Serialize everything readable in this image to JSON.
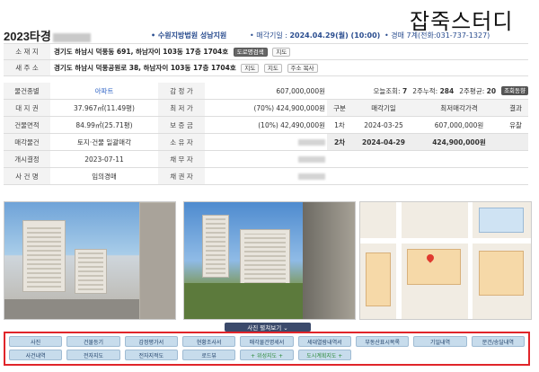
{
  "brand": "잡죽스터디",
  "header": {
    "case_number": "2023타경",
    "court": "• 수원지방법원 성남지원",
    "sale_date_label": "• 매각기일 : ",
    "sale_date": "2024.04.29(월) (10:00)",
    "sale_team": "• 경매 7계(전화:031-737-1327)"
  },
  "address": {
    "location_label": "소 재 지",
    "location": "경기도 하남시 덕풍동 691, 하남자이 103동 17층 1704호",
    "road_label": "새 주 소",
    "road": "경기도 하남시 덕풍공원로 38, 하남자이 103동 17층 1704호",
    "buttons": [
      "도로명검색",
      "지도",
      "지도",
      "지도",
      "주소 복사"
    ]
  },
  "details": [
    {
      "label": "물건종별",
      "value": "아파트",
      "label2": "감 정 가",
      "value2": "607,000,000원"
    },
    {
      "label": "대 지 권",
      "value": "37.967㎡(11.49평)",
      "label2": "최 저 가",
      "value2": "(70%) 424,900,000원"
    },
    {
      "label": "건물면적",
      "value": "84.99㎡(25.71평)",
      "label2": "보 증 금",
      "value2": "(10%) 42,490,000원"
    },
    {
      "label": "매각물건",
      "value": "토지·건물 일괄매각",
      "label2": "소 유 자",
      "value2": ""
    },
    {
      "label": "개시결정",
      "value": "2023-07-11",
      "label2": "채 무 자",
      "value2": ""
    },
    {
      "label": "사 건 명",
      "value": "임의경매",
      "label2": "채 권 자",
      "value2": ""
    }
  ],
  "stats": {
    "today_label": "오늘조회:",
    "today": "7",
    "two_week_label": "2주누적:",
    "two_week": "284",
    "avg_label": "2주평균:",
    "avg": "20",
    "trend_button": "조회동향"
  },
  "history": {
    "headers": [
      "구분",
      "매각기일",
      "최저매각가격",
      "결과"
    ],
    "rows": [
      {
        "round": "1차",
        "date": "2024-03-25",
        "price": "607,000,000원",
        "result": "유찰"
      },
      {
        "round": "2차",
        "date": "2024-04-29",
        "price": "424,900,000원",
        "result": ""
      }
    ]
  },
  "photo_toggle": "사진 펼쳐보기 ⌄",
  "menu": [
    "사진",
    "건물등기",
    "감정평가서",
    "현황조사서",
    "매각물건명세서",
    "세대열람내역서",
    "부동산표시목록",
    "기일내역",
    "문건/송달내역",
    "사건내역",
    "전자지도",
    "전자지적도",
    "로드뷰",
    "+ 위성지도 +",
    "도시계획지도 +",
    "",
    "",
    ""
  ]
}
